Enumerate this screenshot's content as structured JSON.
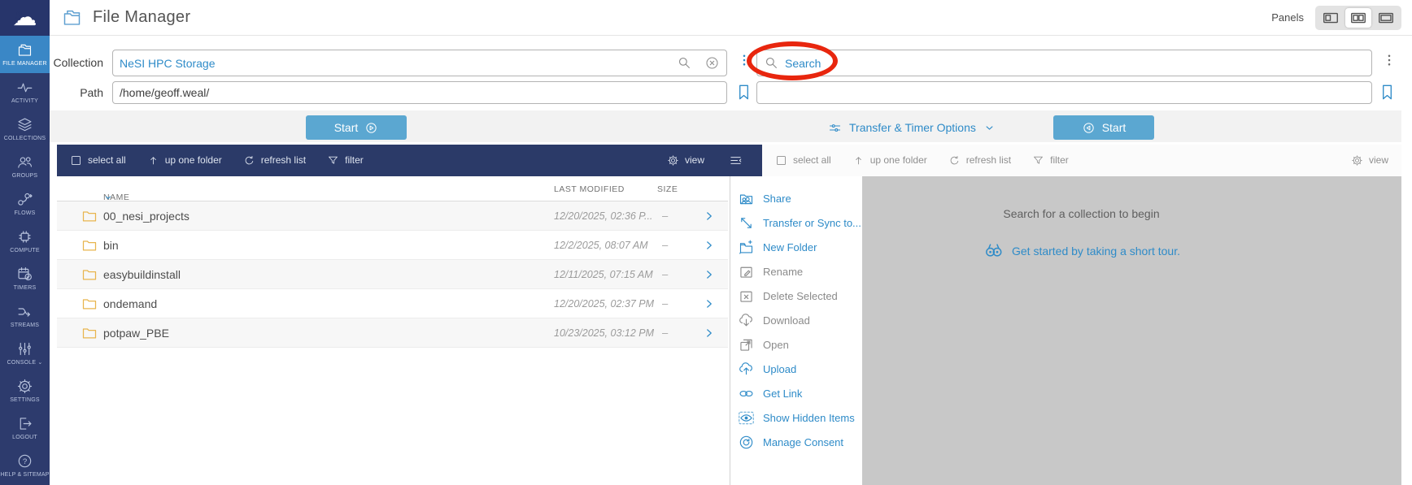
{
  "header": {
    "title": "File Manager",
    "panels_label": "Panels"
  },
  "sidebar": {
    "items": [
      {
        "label": "FILE MANAGER",
        "icon": "folder-double",
        "active": true
      },
      {
        "label": "ACTIVITY",
        "icon": "activity"
      },
      {
        "label": "COLLECTIONS",
        "icon": "collections"
      },
      {
        "label": "GROUPS",
        "icon": "groups"
      },
      {
        "label": "FLOWS",
        "icon": "flows"
      },
      {
        "label": "COMPUTE",
        "icon": "compute"
      },
      {
        "label": "TIMERS",
        "icon": "timers"
      },
      {
        "label": "STREAMS",
        "icon": "streams"
      },
      {
        "label": "CONSOLE",
        "icon": "console",
        "chevron": true
      },
      {
        "label": "SETTINGS",
        "icon": "settings"
      },
      {
        "label": "LOGOUT",
        "icon": "logout"
      },
      {
        "label": "HELP & SITEMAP",
        "icon": "help"
      }
    ]
  },
  "form": {
    "collection_label": "Collection",
    "collection_value": "NeSI HPC Storage",
    "path_label": "Path",
    "path_value": "/home/geoff.weal/",
    "search_placeholder": "Search",
    "right_path_value": ""
  },
  "actions": {
    "start_left": "Start",
    "start_right": "Start",
    "options_label": "Transfer & Timer Options"
  },
  "toolbar": {
    "select_all": "select all",
    "up_one_folder": "up one folder",
    "refresh_list": "refresh list",
    "filter": "filter",
    "view": "view"
  },
  "table": {
    "columns": {
      "name": "NAME",
      "modified": "LAST MODIFIED",
      "size": "SIZE"
    },
    "rows": [
      {
        "name": "00_nesi_projects",
        "modified": "12/20/2025, 02:36 P...",
        "size": "–"
      },
      {
        "name": "bin",
        "modified": "12/2/2025, 08:07 AM",
        "size": "–"
      },
      {
        "name": "easybuildinstall",
        "modified": "12/11/2025, 07:15 AM",
        "size": "–"
      },
      {
        "name": "ondemand",
        "modified": "12/20/2025, 02:37 PM",
        "size": "–"
      },
      {
        "name": "potpaw_PBE",
        "modified": "10/23/2025, 03:12 PM",
        "size": "–"
      }
    ]
  },
  "menu": {
    "items": [
      {
        "label": "Share",
        "icon": "share",
        "enabled": true
      },
      {
        "label": "Transfer or Sync to...",
        "icon": "transfer",
        "enabled": true
      },
      {
        "label": "New Folder",
        "icon": "new-folder",
        "enabled": true
      },
      {
        "label": "Rename",
        "icon": "rename",
        "enabled": false
      },
      {
        "label": "Delete Selected",
        "icon": "delete",
        "enabled": false
      },
      {
        "label": "Download",
        "icon": "download",
        "enabled": false
      },
      {
        "label": "Open",
        "icon": "open",
        "enabled": false
      },
      {
        "label": "Upload",
        "icon": "upload",
        "enabled": true
      },
      {
        "label": "Get Link",
        "icon": "link",
        "enabled": true
      },
      {
        "label": "Show Hidden Items",
        "icon": "eye",
        "enabled": true
      },
      {
        "label": "Manage Consent",
        "icon": "consent",
        "enabled": true
      }
    ]
  },
  "right_panel": {
    "empty_text": "Search for a collection to begin",
    "tour_text": "Get started by taking a short tour."
  },
  "colors": {
    "navy": "#2d3b6d",
    "accent": "#2e8bc8",
    "start_button": "#5ba7d1",
    "annotation_red": "#e8260e",
    "panel_gray": "#c8c8c8"
  }
}
